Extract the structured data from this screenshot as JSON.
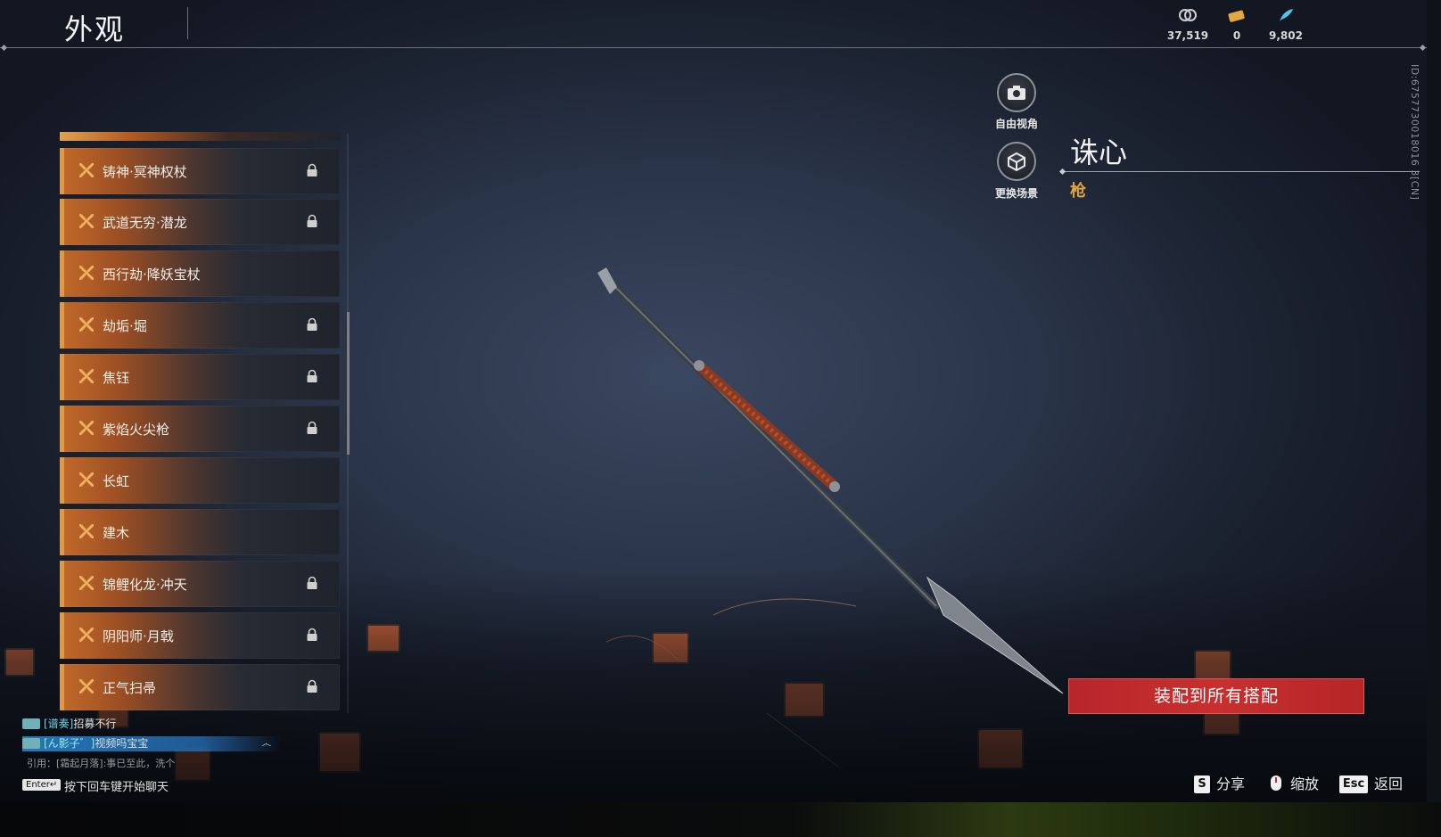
{
  "header": {
    "title": "外观",
    "currencies": [
      {
        "icon": "jade-coin-icon",
        "value": "37,519"
      },
      {
        "icon": "ticket-icon",
        "value": "0"
      },
      {
        "icon": "feather-icon",
        "value": "9,802"
      }
    ],
    "player_id": "ID:6757730018016 3[CN]"
  },
  "list": {
    "items": [
      {
        "name": "铸神·冥神权杖",
        "locked": true
      },
      {
        "name": "武道无穷·潜龙",
        "locked": true
      },
      {
        "name": "西行劫·降妖宝杖",
        "locked": false
      },
      {
        "name": "劫垢·堀",
        "locked": true
      },
      {
        "name": "焦钰",
        "locked": true
      },
      {
        "name": "紫焰火尖枪",
        "locked": true
      },
      {
        "name": "长虹",
        "locked": false
      },
      {
        "name": "建木",
        "locked": false
      },
      {
        "name": "锦鲤化龙·冲天",
        "locked": true
      },
      {
        "name": "阴阳师·月戟",
        "locked": true
      },
      {
        "name": "正气扫帚",
        "locked": true
      }
    ]
  },
  "controls": {
    "free_view_label": "自由视角",
    "change_scene_label": "更换场景"
  },
  "item": {
    "name": "诛心",
    "type": "枪"
  },
  "equip_button": "装配到所有搭配",
  "chat": {
    "messages": [
      {
        "channel": "[谱奏]",
        "text": "招募不行"
      },
      {
        "channel": "[ん影子゛]",
        "text": "视频吗宝宝"
      }
    ],
    "quote": "引用：[霜起月落]:事已至此，洗个",
    "enter_key": "Enter↵",
    "enter_hint": "按下回车键开始聊天"
  },
  "hints": [
    {
      "key": "S",
      "label": "分享"
    },
    {
      "key": "zoom-mouse-icon",
      "label": "缩放"
    },
    {
      "key": "Esc",
      "label": "返回"
    }
  ],
  "colors": {
    "accent_orange": "#e09a45",
    "item_type_gold": "#e0a542",
    "equip_red": "#c8302f"
  }
}
